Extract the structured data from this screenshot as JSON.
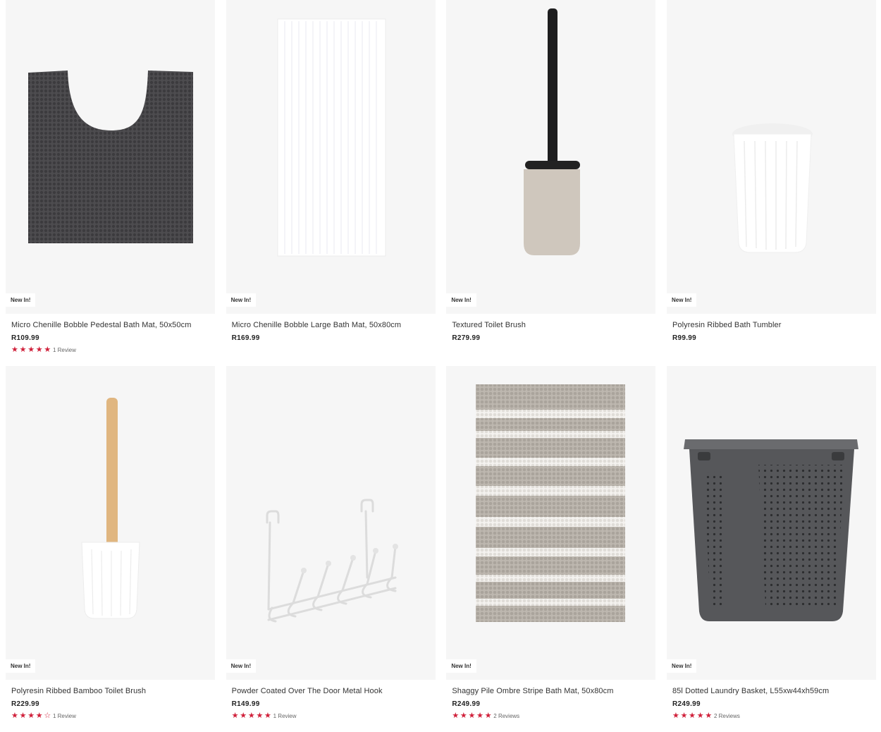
{
  "products": [
    {
      "badge": "New In!",
      "title": "Micro Chenille Bobble Pedestal Bath Mat, 50x50cm",
      "price": "R109.99",
      "rating": 5,
      "reviews": "1 Review",
      "icon": "pedestal-bath-mat-image",
      "color": "#4a4a4c"
    },
    {
      "badge": "New In!",
      "title": "Micro Chenille Bobble Large Bath Mat, 50x80cm",
      "price": "R169.99",
      "rating": null,
      "reviews": "",
      "icon": "large-bath-mat-image",
      "color": "#ffffff"
    },
    {
      "badge": "New In!",
      "title": "Textured Toilet Brush",
      "price": "R279.99",
      "rating": null,
      "reviews": "",
      "icon": "toilet-brush-image",
      "color": "#cfc7bd"
    },
    {
      "badge": "New In!",
      "title": "Polyresin Ribbed Bath Tumbler",
      "price": "R99.99",
      "rating": null,
      "reviews": "",
      "icon": "bath-tumbler-image",
      "color": "#ffffff"
    },
    {
      "badge": "New In!",
      "title": "Polyresin Ribbed Bamboo Toilet Brush",
      "price": "R229.99",
      "rating": 4,
      "reviews": "1 Review",
      "icon": "bamboo-toilet-brush-image",
      "color": "#e0b680"
    },
    {
      "badge": "New In!",
      "title": "Powder Coated Over The Door Metal Hook",
      "price": "R149.99",
      "rating": 5,
      "reviews": "1 Review",
      "icon": "door-hook-image",
      "color": "#e2e2e2"
    },
    {
      "badge": "New In!",
      "title": "Shaggy Pile Ombre Stripe Bath Mat, 50x80cm",
      "price": "R249.99",
      "rating": 5,
      "reviews": "2 Reviews",
      "icon": "stripe-bath-mat-image",
      "color": "#bcb6ae"
    },
    {
      "badge": "New In!",
      "title": "85l Dotted Laundry Basket, L55xw44xh59cm",
      "price": "R249.99",
      "rating": 5,
      "reviews": "2 Reviews",
      "icon": "laundry-basket-image",
      "color": "#56575a"
    }
  ],
  "star_color": "#d0203a"
}
